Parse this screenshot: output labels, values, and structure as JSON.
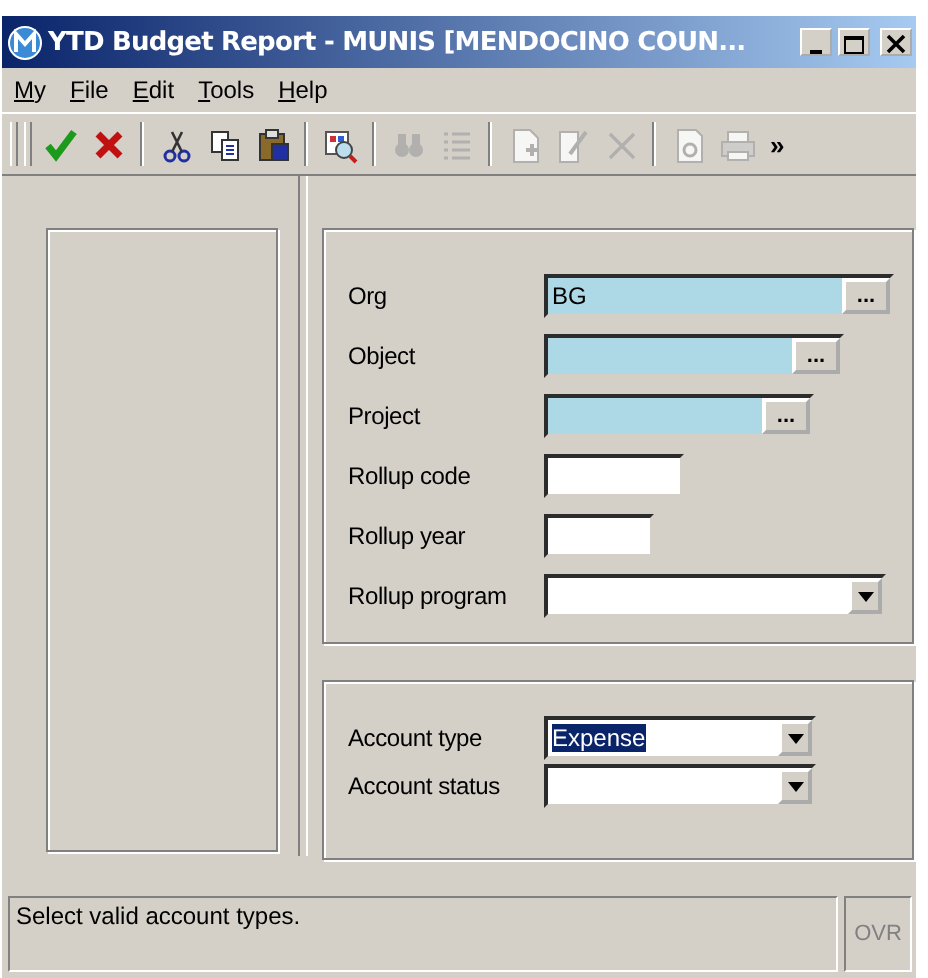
{
  "window": {
    "title": "YTD Budget Report - MUNIS [MENDOCINO COUN..."
  },
  "menu": [
    {
      "label": "My"
    },
    {
      "label": "File"
    },
    {
      "label": "Edit"
    },
    {
      "label": "Tools"
    },
    {
      "label": "Help"
    }
  ],
  "toolbar": {
    "items": [
      {
        "kind": "accept",
        "disabled": false
      },
      {
        "kind": "cancel",
        "disabled": false
      },
      {
        "kind": "separator"
      },
      {
        "kind": "cut",
        "disabled": false
      },
      {
        "kind": "copy",
        "disabled": false
      },
      {
        "kind": "paste",
        "disabled": false
      },
      {
        "kind": "separator"
      },
      {
        "kind": "browse",
        "disabled": false
      },
      {
        "kind": "separator"
      },
      {
        "kind": "find",
        "disabled": true
      },
      {
        "kind": "list",
        "disabled": true
      },
      {
        "kind": "separator"
      },
      {
        "kind": "add",
        "disabled": true
      },
      {
        "kind": "edit",
        "disabled": true
      },
      {
        "kind": "delete",
        "disabled": true
      },
      {
        "kind": "separator"
      },
      {
        "kind": "preview",
        "disabled": true
      },
      {
        "kind": "print",
        "disabled": true
      }
    ],
    "overflow": "»"
  },
  "criteria": {
    "fields": [
      {
        "label": "Org",
        "kind": "lookup",
        "value": "BG",
        "lookup_button": "..."
      },
      {
        "label": "Object",
        "kind": "lookup",
        "lookup_button": "..."
      },
      {
        "label": "Project",
        "kind": "lookup",
        "lookup_button": "..."
      },
      {
        "label": "Rollup code",
        "kind": "text"
      },
      {
        "label": "Rollup year",
        "kind": "text"
      },
      {
        "label": "Rollup program",
        "kind": "dropdown"
      }
    ]
  },
  "account": {
    "fields": [
      {
        "label": "Account type",
        "kind": "dropdown",
        "value": "Expense",
        "highlighted": true
      },
      {
        "label": "Account status",
        "kind": "dropdown"
      }
    ]
  },
  "status_bar": {
    "message": "Select valid account types.",
    "indicator": {
      "label": "OVR",
      "active": false
    }
  }
}
